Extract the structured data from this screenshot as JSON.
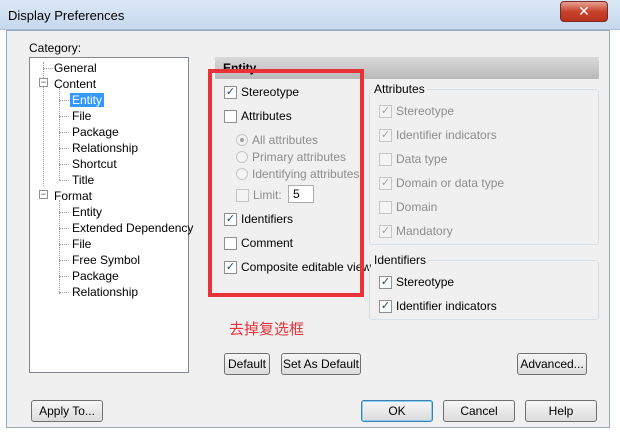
{
  "window": {
    "title": "Display Preferences",
    "close_glyph": "✕"
  },
  "category": {
    "label": "Category:",
    "tree": {
      "general": "General",
      "content": "Content",
      "content_children": [
        "Entity",
        "File",
        "Package",
        "Relationship",
        "Shortcut",
        "Title"
      ],
      "format": "Format",
      "format_children": [
        "Entity",
        "Extended Dependency",
        "File",
        "Free Symbol",
        "Package",
        "Relationship"
      ],
      "selected": "Entity"
    }
  },
  "panel": {
    "header": "Entity",
    "left_options": {
      "stereotype": {
        "label": "Stereotype",
        "checked": true
      },
      "attributes": {
        "label": "Attributes",
        "checked": false
      },
      "radios": [
        "All attributes",
        "Primary attributes",
        "Identifying attributes"
      ],
      "limit": {
        "label": "Limit:",
        "value": "5",
        "checked": false
      },
      "identifiers": {
        "label": "Identifiers",
        "checked": true
      },
      "comment": {
        "label": "Comment",
        "checked": false
      },
      "composite": {
        "label": "Composite editable view",
        "checked": true
      }
    },
    "attributes_group": {
      "title": "Attributes",
      "items": [
        "Stereotype",
        "Identifier indicators",
        "Data type",
        "Domain or data type",
        "Domain",
        "Mandatory"
      ]
    },
    "identifiers_group": {
      "title": "Identifiers",
      "items": [
        "Stereotype",
        "Identifier indicators"
      ]
    },
    "annotation": "去掉复选框"
  },
  "buttons": {
    "default": "Default",
    "set_as_default": "Set As Default",
    "advanced": "Advanced...",
    "apply_to": "Apply To...",
    "ok": "OK",
    "cancel": "Cancel",
    "help": "Help"
  },
  "colors": {
    "highlight": "#e8323a",
    "selection": "#3399ff",
    "close": "#c7432c"
  },
  "icons": {
    "check": "check-icon",
    "close": "close-icon",
    "expander": "minus-expander-icon"
  }
}
